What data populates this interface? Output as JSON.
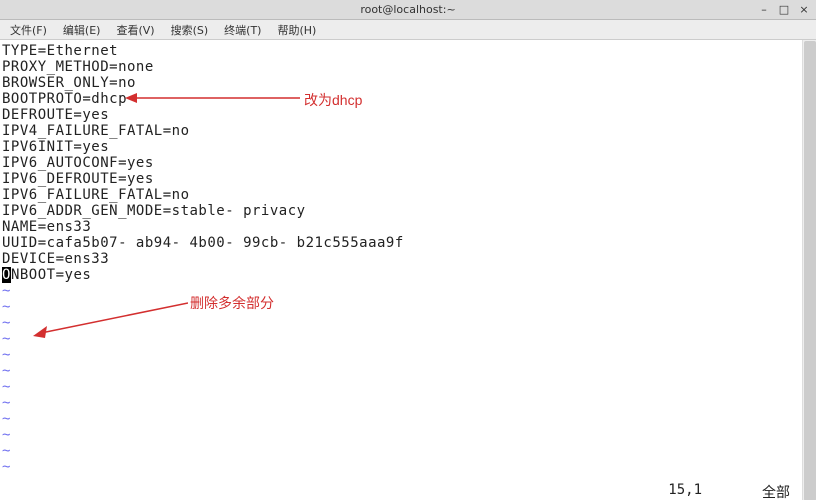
{
  "titlebar": {
    "title": "root@localhost:~"
  },
  "menubar": {
    "items": [
      {
        "label": "文件(F)"
      },
      {
        "label": "编辑(E)"
      },
      {
        "label": "查看(V)"
      },
      {
        "label": "搜索(S)"
      },
      {
        "label": "终端(T)"
      },
      {
        "label": "帮助(H)"
      }
    ]
  },
  "editor": {
    "lines": [
      "TYPE=Ethernet",
      "PROXY_METHOD=none",
      "BROWSER_ONLY=no",
      "BOOTPROTO=dhcp",
      "DEFROUTE=yes",
      "IPV4_FAILURE_FATAL=no",
      "IPV6INIT=yes",
      "IPV6_AUTOCONF=yes",
      "IPV6_DEFROUTE=yes",
      "IPV6_FAILURE_FATAL=no",
      "IPV6_ADDR_GEN_MODE=stable- privacy",
      "NAME=ens33",
      "UUID=cafa5b07- ab94- 4b00- 99cb- b21c555aaa9f",
      "DEVICE=ens33"
    ],
    "cursor_line_prefix": "O",
    "cursor_line_rest": "NBOOT=yes",
    "tilde": "~"
  },
  "statusbar": {
    "position": "15,1",
    "scope": "全部"
  },
  "annotations": {
    "annotation1": "改为dhcp",
    "annotation2": "删除多余部分"
  }
}
